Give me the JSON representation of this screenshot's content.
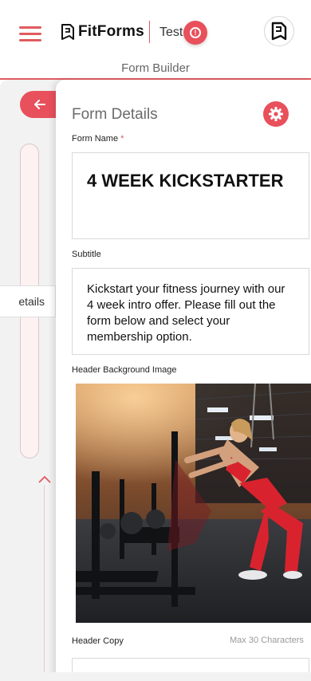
{
  "header": {
    "brand": "FitForms",
    "account": "Test",
    "subtitle": "Form Builder"
  },
  "sidebar": {
    "section_label": "etails"
  },
  "form": {
    "title": "Form Details",
    "name_label": "Form Name",
    "required_mark": "*",
    "name_value": "4 WEEK KICKSTARTER",
    "subtitle_label": "Subtitle",
    "subtitle_value": "Kickstart your fitness journey with our 4 week intro offer. Please fill out the form below and select your membership option.",
    "header_image_label": "Header Background Image",
    "header_copy_label": "Header Copy",
    "header_copy_hint": "Max 30 Characters",
    "header_copy_value": ""
  },
  "icons": {
    "menu": "hamburger-menu-icon",
    "logo": "fitforms-logo-icon",
    "alert": "alert-icon",
    "account": "account-icon",
    "back": "arrow-left-icon",
    "settings": "gear-icon",
    "collapse": "chevron-up-icon"
  },
  "colors": {
    "accent": "#e8505b",
    "background": "#f2f2f2"
  }
}
